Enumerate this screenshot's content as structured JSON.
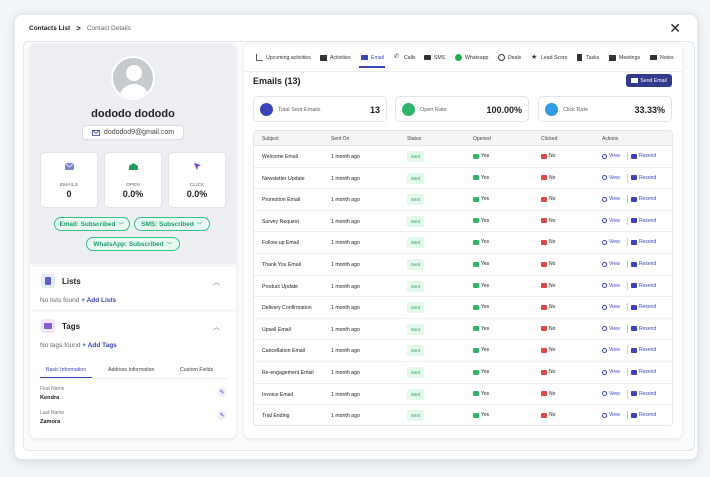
{
  "breadcrumb": {
    "parent": "Contacts List",
    "separator": ">",
    "current": "Contact Details"
  },
  "contact": {
    "name": "dododo dododo",
    "email": "dododod9@gmail.com",
    "stats": [
      {
        "label": "EMAILS",
        "value": "0",
        "icon": "mail-icon",
        "color": "#7b83d6"
      },
      {
        "label": "OPEN",
        "value": "0.0%",
        "icon": "open-mail-icon",
        "color": "#1f9e5e"
      },
      {
        "label": "CLICK",
        "value": "0.0%",
        "icon": "cursor-icon",
        "color": "#7a3fd6"
      }
    ],
    "subscriptions": [
      "Email: Subscribed",
      "SMS: Subscribed",
      "WhatsApp: Subscribed"
    ]
  },
  "lists": {
    "title": "Lists",
    "empty": "No lists found",
    "add": "+ Add Lists"
  },
  "tags": {
    "title": "Tags",
    "empty": "No tags found",
    "add": "+ Add Tags"
  },
  "subtabs": [
    "Basic Information",
    "Address Information",
    "Custom Fields"
  ],
  "fields": [
    {
      "label": "First Name",
      "value": "Kendra"
    },
    {
      "label": "Last  Name",
      "value": "Zamora"
    }
  ],
  "tabs": [
    {
      "label": "Upcoming activities",
      "icon": "chart-icon"
    },
    {
      "label": "Activities",
      "icon": "calendar-icon"
    },
    {
      "label": "Email",
      "icon": "mail-icon"
    },
    {
      "label": "Calls",
      "icon": "phone-icon"
    },
    {
      "label": "SMS",
      "icon": "sms-icon"
    },
    {
      "label": "Whatsapp",
      "icon": "whatsapp-icon"
    },
    {
      "label": "Deals",
      "icon": "deals-icon"
    },
    {
      "label": "Lead Score",
      "icon": "star-icon"
    },
    {
      "label": "Tasks",
      "icon": "clipboard-icon"
    },
    {
      "label": "Meetings",
      "icon": "calendar-icon"
    },
    {
      "label": "Notes",
      "icon": "note-icon"
    }
  ],
  "emails": {
    "title": "Emails (13)",
    "send_button": "Send Email",
    "kpis": [
      {
        "label": "Total Sent Emails",
        "value": "13",
        "color": "#3b44b8"
      },
      {
        "label": "Open Rate",
        "value": "100.00%",
        "color": "#2fb567"
      },
      {
        "label": "Click Rate",
        "value": "33.33%",
        "color": "#2f9be0"
      }
    ],
    "columns": [
      "Subject",
      "Sent On",
      "Status",
      "Opened",
      "Clicked",
      "Actions"
    ],
    "rows": [
      {
        "subject": "Welcome Email",
        "sent": "1 month ago",
        "status": "Sent",
        "opened": "Yes",
        "clicked": "No"
      },
      {
        "subject": "Newsletter Update",
        "sent": "1 month ago",
        "status": "Sent",
        "opened": "Yes",
        "clicked": "No"
      },
      {
        "subject": "Promotion Email",
        "sent": "1 month ago",
        "status": "Sent",
        "opened": "Yes",
        "clicked": "No"
      },
      {
        "subject": "Survey Request",
        "sent": "1 month ago",
        "status": "Sent",
        "opened": "Yes",
        "clicked": "No"
      },
      {
        "subject": "Follow-up Email",
        "sent": "1 month ago",
        "status": "Sent",
        "opened": "Yes",
        "clicked": "No"
      },
      {
        "subject": "Thank You Email",
        "sent": "1 month ago",
        "status": "Sent",
        "opened": "Yes",
        "clicked": "No"
      },
      {
        "subject": "Product Update",
        "sent": "1 month ago",
        "status": "Sent",
        "opened": "Yes",
        "clicked": "No"
      },
      {
        "subject": "Delivery Confirmation",
        "sent": "1 month ago",
        "status": "Sent",
        "opened": "Yes",
        "clicked": "No"
      },
      {
        "subject": "Upsell Email",
        "sent": "1 month ago",
        "status": "Sent",
        "opened": "Yes",
        "clicked": "No"
      },
      {
        "subject": "Cancellation Email",
        "sent": "1 month ago",
        "status": "Sent",
        "opened": "Yes",
        "clicked": "No"
      },
      {
        "subject": "Re-engagement Email",
        "sent": "1 month ago",
        "status": "Sent",
        "opened": "Yes",
        "clicked": "No"
      },
      {
        "subject": "Invoice Email",
        "sent": "1 month ago",
        "status": "Sent",
        "opened": "Yes",
        "clicked": "No"
      },
      {
        "subject": "Trial Ending",
        "sent": "1 month ago",
        "status": "Sent",
        "opened": "Yes",
        "clicked": "No"
      }
    ],
    "action_view": "View",
    "action_resend": "Resend"
  }
}
